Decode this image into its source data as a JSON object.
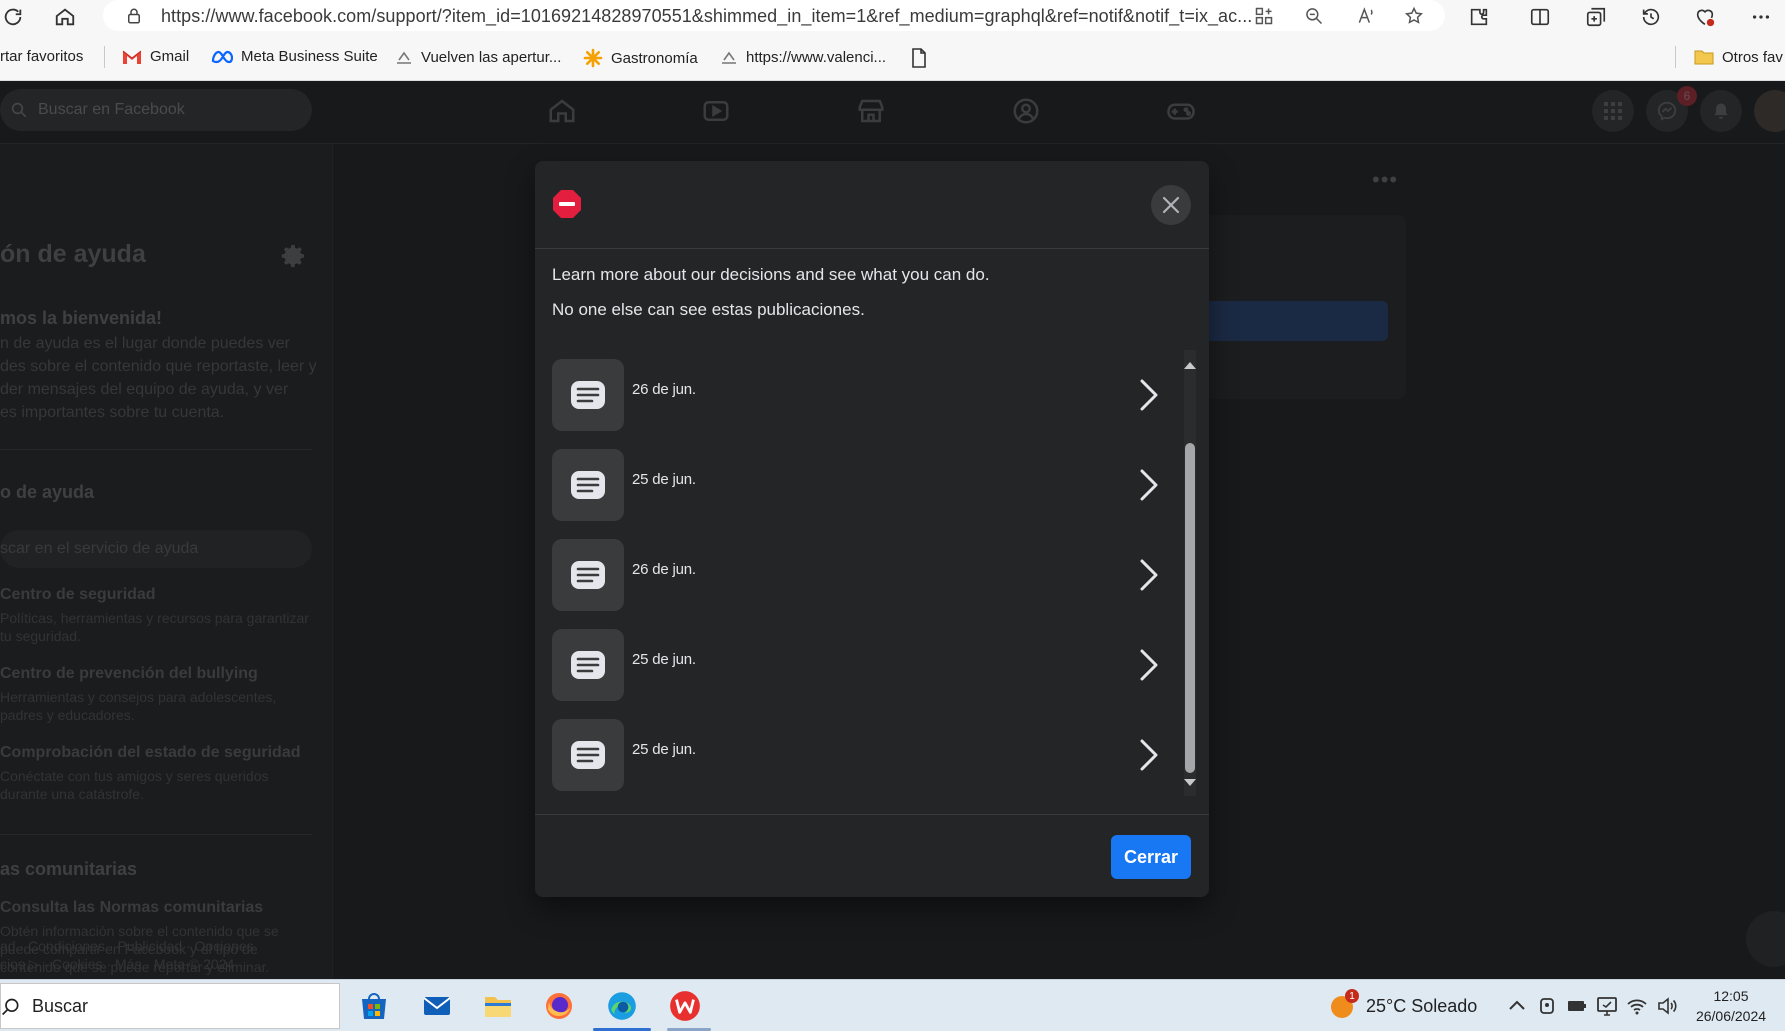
{
  "browser": {
    "url": "https://www.facebook.com/support/?item_id=10169214828970551&shimmed_in_item=1&ref_medium=graphql&ref=notif&notif_t=ix_ac...",
    "bookmarks": [
      {
        "label": "rtar favoritos",
        "icon": "import-favorites-icon"
      },
      {
        "label": "Gmail",
        "icon": "gmail-icon"
      },
      {
        "label": "Meta Business Suite",
        "icon": "meta-icon"
      },
      {
        "label": "Vuelven las apertur...",
        "icon": "site-icon"
      },
      {
        "label": "Gastronomía",
        "icon": "star-burst-icon"
      },
      {
        "label": "https://www.valenci...",
        "icon": "site-icon"
      }
    ],
    "other_favorites": "Otros fav"
  },
  "facebook": {
    "search_placeholder": "Buscar en Facebook",
    "messenger_badge": "6",
    "sidebar": {
      "title": "ón de ayuda",
      "welcome_title": "mos la bienvenida!",
      "welcome_lines": [
        "n de ayuda es el lugar donde puedes ver",
        "des sobre el contenido que reportaste, leer y",
        "der mensajes del equipo de ayuda, y ver",
        "es importantes sobre tu cuenta."
      ],
      "service_title": "o de ayuda",
      "service_search_placeholder": "scar en el servicio de ayuda",
      "links": [
        {
          "title": "Centro de seguridad",
          "desc": [
            "Políticas, herramientas y recursos para garantizar",
            "tu seguridad."
          ]
        },
        {
          "title": "Centro de prevención del bullying",
          "desc": [
            "Herramientas y consejos para adolescentes,",
            "padres y educadores."
          ]
        },
        {
          "title": "Comprobación del estado de seguridad",
          "desc": [
            "Conéctate con tus amigos y seres queridos",
            "durante una catástrofe."
          ]
        }
      ],
      "community_title": "as comunitarias",
      "community_link": {
        "title": "Consulta las Normas comunitarias",
        "desc": [
          "Obtén información sobre el contenido que se",
          "puede compartir en Facebook y el tipo de",
          "contenido que se puede reportar y eliminar."
        ]
      },
      "footer_lines": [
        "ad · Condiciones · Publicidad · Opciones",
        "cios ▷ · Cookies · Más · Meta © 2024"
      ]
    }
  },
  "dialog": {
    "line1": "Learn more about our decisions and see what you can do.",
    "line2": "No one else can see estas publicaciones.",
    "posts": [
      {
        "date": "26 de jun."
      },
      {
        "date": "25 de jun."
      },
      {
        "date": "26 de jun."
      },
      {
        "date": "25 de jun."
      },
      {
        "date": "25 de jun."
      }
    ],
    "close_button": "Cerrar"
  },
  "taskbar": {
    "search_placeholder": "Buscar",
    "weather": "25°C  Soleado",
    "weather_badge": "1",
    "time": "12:05",
    "date": "26/06/2024"
  },
  "colors": {
    "accent": "#1877f2",
    "dialog_bg": "#242526",
    "blocked_red": "#e41e3f"
  }
}
